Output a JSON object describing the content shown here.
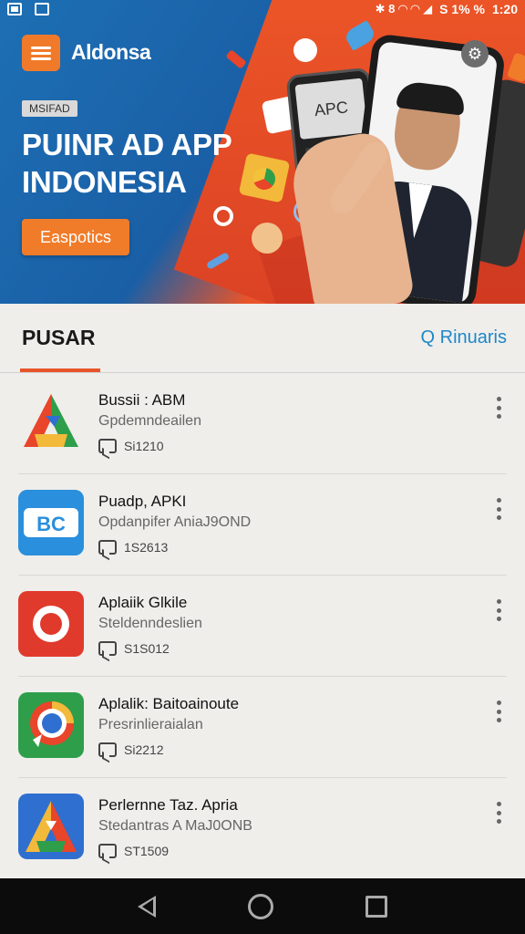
{
  "status_bar": {
    "right_glyphs": "✱ 8 ◠ ◠ ◢",
    "battery": "S 1% %",
    "time": "1:20"
  },
  "banner": {
    "brand": "Aldonsa",
    "tag": "MSIFAD",
    "headline_line1": "PUINR AD APP",
    "headline_line2": "INDONESIA",
    "cta": "Easpotics",
    "phone_screen_text": "APC"
  },
  "tabs": {
    "active": "PUSAR",
    "search": "Q Rinuaris"
  },
  "apps": [
    {
      "title": "Bussii : ABM",
      "subtitle": "Gpdemndeailen",
      "meta": "Si1210",
      "icon": "tri-color-a-icon"
    },
    {
      "title": "Puadp, APKI",
      "subtitle": "Opdanpifer AniaJ9OND",
      "meta": "1S2613",
      "icon": "bc-icon"
    },
    {
      "title": "Aplaiik Glkile",
      "subtitle": "Steldenndeslien",
      "meta": "S1S012",
      "icon": "red-ring-icon"
    },
    {
      "title": "Aplalik: Baitoainoute",
      "subtitle": "Presrinlieraialan",
      "meta": "Si2212",
      "icon": "chat-globe-icon"
    },
    {
      "title": "Perlernne Taz. Apria",
      "subtitle": "Stedantras A MaJ0ONB",
      "meta": "ST1509",
      "icon": "blue-a-icon"
    }
  ],
  "colors": {
    "accent_orange": "#e8542a",
    "link_blue": "#1e87c8",
    "banner_blue": "#1d6fb4"
  }
}
